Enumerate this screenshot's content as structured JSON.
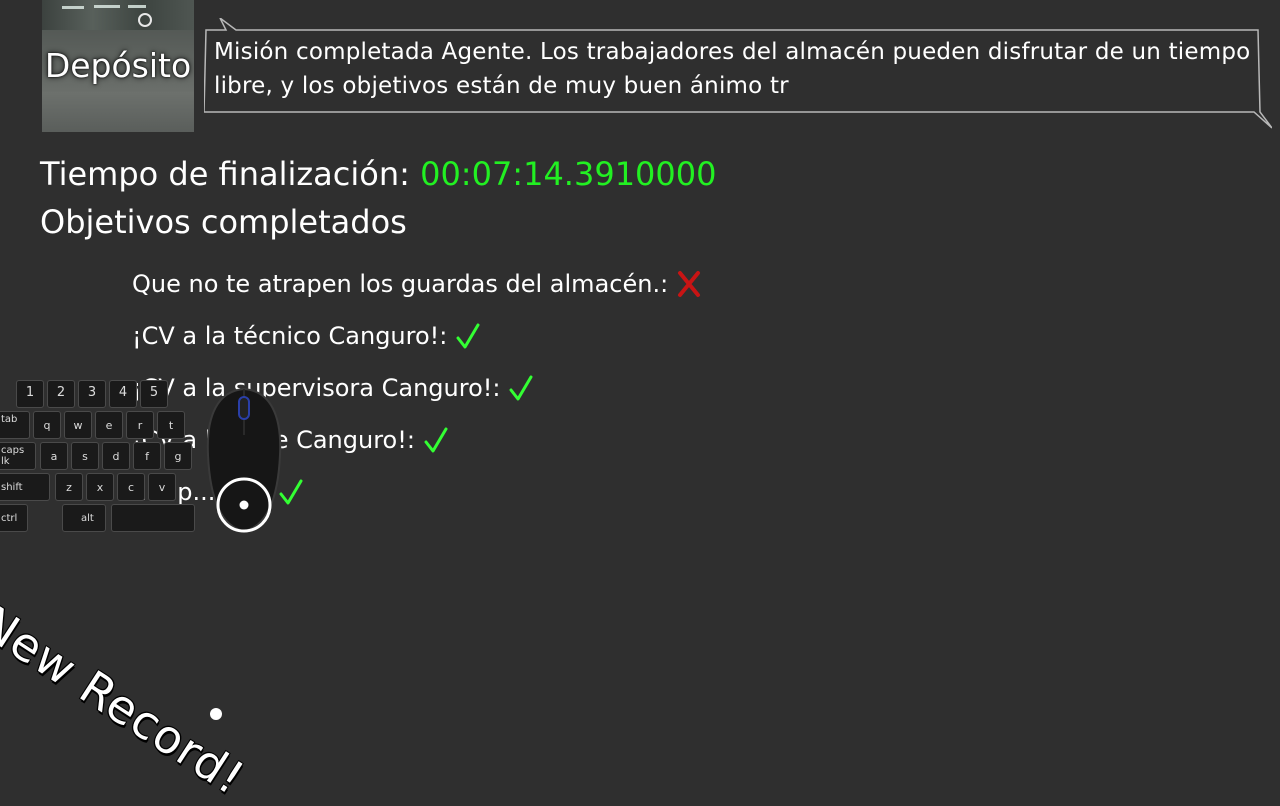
{
  "location": {
    "name": "Depósito"
  },
  "dialogue": {
    "text": "Misión completada Agente. Los trabajadores del almacén pueden disfrutar de un tiempo libre, y los objetivos están de muy buen ánimo tr"
  },
  "results": {
    "time_label": "Tiempo de finalización: ",
    "time_value": "00:07:14.3910000",
    "objectives_title": "Objetivos completados",
    "objectives": [
      {
        "label": "Que no te atrapen los guardas del almacén.:",
        "status": "failed"
      },
      {
        "label": "¡CV a la técnico Canguro!:",
        "status": "completed"
      },
      {
        "label": "¡CV a la supervisora Canguro!:",
        "status": "completed"
      },
      {
        "label": "¡CV a la ... te Canguro!:",
        "status": "completed"
      },
      {
        "label": "... ap... ea!:",
        "status": "completed"
      }
    ]
  },
  "overlay": {
    "keyboard_keys": {
      "row_numbers": [
        "1",
        "2",
        "3",
        "4",
        "5"
      ],
      "row_q": [
        "tab",
        "q",
        "w",
        "e",
        "r",
        "t"
      ],
      "row_a": [
        "caps lk",
        "a",
        "s",
        "d",
        "f",
        "g"
      ],
      "row_z": [
        "shift",
        "z",
        "x",
        "c",
        "v"
      ],
      "row_bottom": [
        "ctrl",
        "alt"
      ]
    },
    "new_record": "New Record!"
  },
  "colors": {
    "background": "#2f2f2f",
    "time_value": "#22f022",
    "check": "#33ff33",
    "cross": "#c81414"
  },
  "icons": {
    "completed": "check-icon",
    "failed": "cross-icon"
  }
}
